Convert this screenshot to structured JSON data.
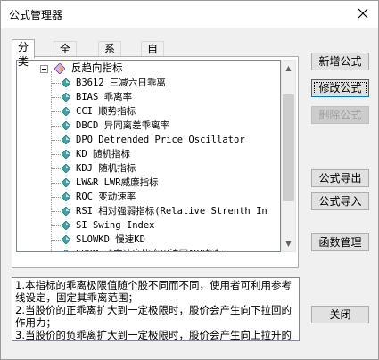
{
  "window": {
    "title": "公式管理器",
    "close_icon": "close-icon"
  },
  "tabs": [
    {
      "label": "分类",
      "active": true
    },
    {
      "label": "全部",
      "active": false
    },
    {
      "label": "系统",
      "active": false
    },
    {
      "label": "自定义",
      "active": false
    }
  ],
  "tree": {
    "parent": {
      "label": "反趋向指标",
      "expanded": true
    },
    "items": [
      {
        "label": "B3612 三减六日乖离"
      },
      {
        "label": "BIAS 乖离率"
      },
      {
        "label": "CCI 顺势指标"
      },
      {
        "label": "DBCD 异同离差乖离率"
      },
      {
        "label": "DPO Detrended Price Oscillator"
      },
      {
        "label": "KD 随机指标"
      },
      {
        "label": "KDJ 随机指标"
      },
      {
        "label": "LW&R LWR威廉指标"
      },
      {
        "label": "ROC 变动速率"
      },
      {
        "label": "RSI 相对强弱指标(Relative Strenth In"
      },
      {
        "label": "SI Swing Index"
      },
      {
        "label": "SLOWKD 慢速KD"
      },
      {
        "label": "SRDM 动向速度比率用法同ADX指标"
      }
    ]
  },
  "buttons": {
    "new": "新增公式",
    "edit": "修改公式",
    "delete": "删除公式",
    "export": "公式导出",
    "import": "公式导入",
    "functions": "函数管理",
    "close": "关闭"
  },
  "description": "1.本指标的乖离极限值随个股不同而不同，使用者可利用参考线设定，固定其乖离范围；\n2.当股价的正乖离扩大到一定极限时，股价会产生向下拉回的作用力；\n3.当股价的负乖离扩大到一定极限时，股价会产生向上拉升的作用力；",
  "colors": {
    "accent": "#0078d7",
    "window_bg": "#f0f0f0",
    "gem_teal": "#3aa6a6"
  }
}
